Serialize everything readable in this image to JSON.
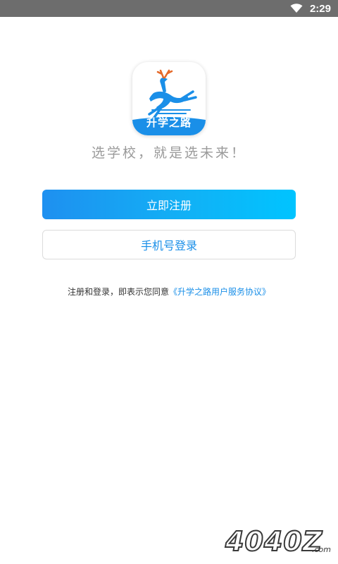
{
  "status_bar": {
    "time": "2:29",
    "wifi_icon": "wifi-icon"
  },
  "logo": {
    "text": "升学之路",
    "brand_color": "#1a8fe8"
  },
  "slogan": "选学校，就是选未来！",
  "buttons": {
    "register_label": "立即注册",
    "login_label": "手机号登录"
  },
  "agreement": {
    "prefix": "注册和登录，即表示您同意",
    "link_text": "《升学之路用户服务协议》"
  },
  "watermark": {
    "text": "4040Z",
    "suffix": ".com"
  },
  "colors": {
    "accent": "#1a8fe8",
    "gradient_start": "#1e90f0",
    "gradient_end": "#00c4ff",
    "status_bar": "#6d6d6d"
  }
}
